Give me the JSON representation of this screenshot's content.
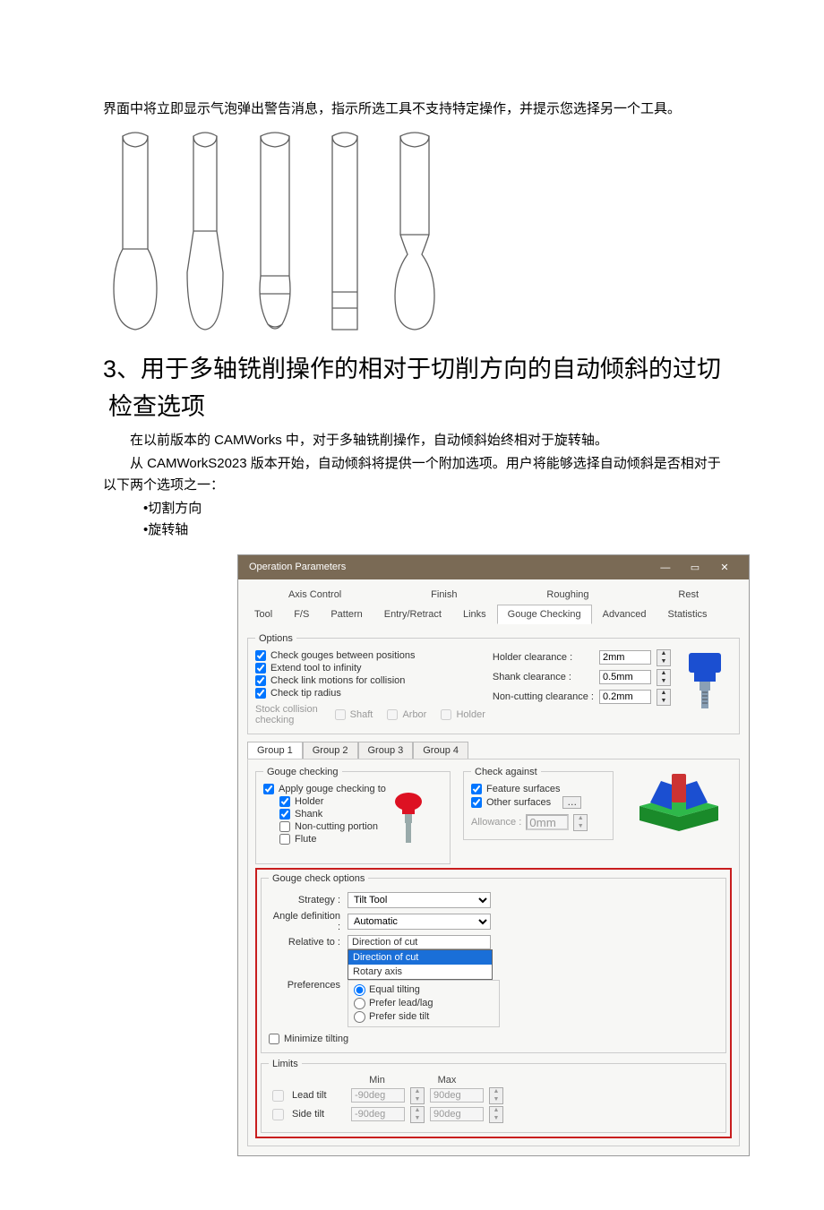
{
  "intro": "界面中将立即显示气泡弹出警告消息，指示所选工具不支持特定操作，并提示您选择另一个工具。",
  "section_title": "3、用于多轴铣削操作的相对于切削方向的自动倾斜的过切检查选项",
  "p1": "在以前版本的 CAMWorks 中，对于多轴铣削操作，自动倾斜始终相对于旋转轴。",
  "p2": "从 CAMWorkS2023 版本开始，自动倾斜将提供一个附加选项。用户将能够选择自动倾斜是否相对于以下两个选项之一：",
  "bullet1": "•切割方向",
  "bullet2": "•旋转轴",
  "dialog": {
    "title": "Operation Parameters",
    "tabs_row1": [
      "Axis Control",
      "Finish",
      "Roughing",
      "Rest"
    ],
    "tabs_row2": [
      "Tool",
      "F/S",
      "Pattern",
      "Entry/Retract",
      "Links",
      "Gouge Checking",
      "Advanced",
      "Statistics"
    ],
    "active_tab": "Gouge Checking",
    "options": {
      "legend": "Options",
      "checks": [
        {
          "label": "Check gouges between positions",
          "checked": true
        },
        {
          "label": "Extend tool to infinity",
          "checked": true
        },
        {
          "label": "Check link motions for collision",
          "checked": true
        },
        {
          "label": "Check tip radius",
          "checked": true
        }
      ],
      "stock_collision": "Stock collision checking",
      "stock_items": [
        "Shaft",
        "Arbor",
        "Holder"
      ],
      "clearance": [
        {
          "label": "Holder clearance :",
          "value": "2mm"
        },
        {
          "label": "Shank clearance :",
          "value": "0.5mm"
        },
        {
          "label": "Non-cutting clearance :",
          "value": "0.2mm"
        }
      ]
    },
    "group_tabs": [
      "Group 1",
      "Group 2",
      "Group 3",
      "Group 4"
    ],
    "gouge_checking": {
      "legend": "Gouge checking",
      "apply": "Apply gouge checking to",
      "items": [
        {
          "label": "Holder",
          "checked": true
        },
        {
          "label": "Shank",
          "checked": true
        },
        {
          "label": "Non-cutting portion",
          "checked": false
        },
        {
          "label": "Flute",
          "checked": false
        }
      ]
    },
    "check_against": {
      "legend": "Check against",
      "items": [
        {
          "label": "Feature surfaces",
          "checked": true
        },
        {
          "label": "Other surfaces",
          "checked": true
        }
      ],
      "allowance_label": "Allowance :",
      "allowance_value": "0mm"
    },
    "gouge_options": {
      "legend": "Gouge check options",
      "strategy_label": "Strategy :",
      "strategy_value": "Tilt Tool",
      "angle_label": "Angle definition :",
      "angle_value": "Automatic",
      "relative_label": "Relative to :",
      "relative_value": "Direction of cut",
      "relative_options": [
        "Direction of cut",
        "Rotary axis"
      ],
      "pref_label": "Preferences",
      "pref_items": [
        "Equal tilting",
        "Prefer lead/lag",
        "Prefer side tilt"
      ],
      "minimize": "Minimize tilting"
    },
    "limits": {
      "legend": "Limits",
      "min": "Min",
      "max": "Max",
      "rows": [
        {
          "label": "Lead tilt",
          "min": "-90deg",
          "max": "90deg"
        },
        {
          "label": "Side tilt",
          "min": "-90deg",
          "max": "90deg"
        }
      ]
    }
  }
}
